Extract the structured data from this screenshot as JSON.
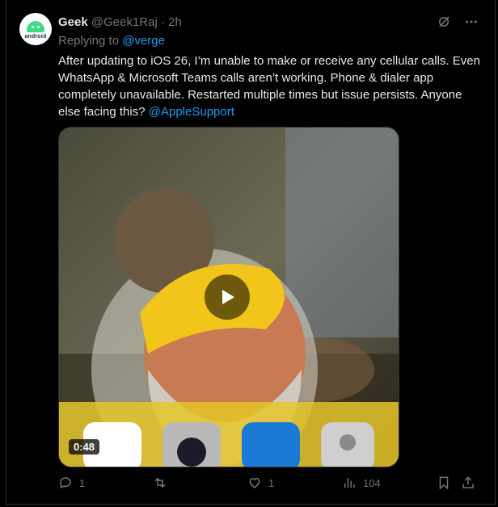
{
  "tweet": {
    "author_name": "Geek",
    "author_handle": "@Geek1Raj",
    "separator": "·",
    "time": "2h",
    "replying_prefix": "Replying to",
    "replying_to": "@verge",
    "body": "After updating to iOS 26, I’m unable to make or receive any cellular calls. Even WhatsApp & Microsoft Teams calls aren’t working. Phone & dialer app completely unavailable. Restarted multiple times but issue persists. Anyone else facing this?",
    "body_mention": "@AppleSupport",
    "avatar_text": "android"
  },
  "media": {
    "duration": "0:48"
  },
  "actions": {
    "replies": "1",
    "reposts": "",
    "likes": "1",
    "views": "104"
  },
  "icons": {
    "top": [
      "grok-icon",
      "more-icon"
    ],
    "actions": [
      "reply-icon",
      "repost-icon",
      "like-icon",
      "views-icon",
      "bookmark-icon",
      "share-icon"
    ]
  },
  "colors": {
    "background": "#000000",
    "text": "#e7e9ea",
    "muted": "#71767b",
    "link": "#1d9bf0",
    "border": "#2f3336"
  }
}
